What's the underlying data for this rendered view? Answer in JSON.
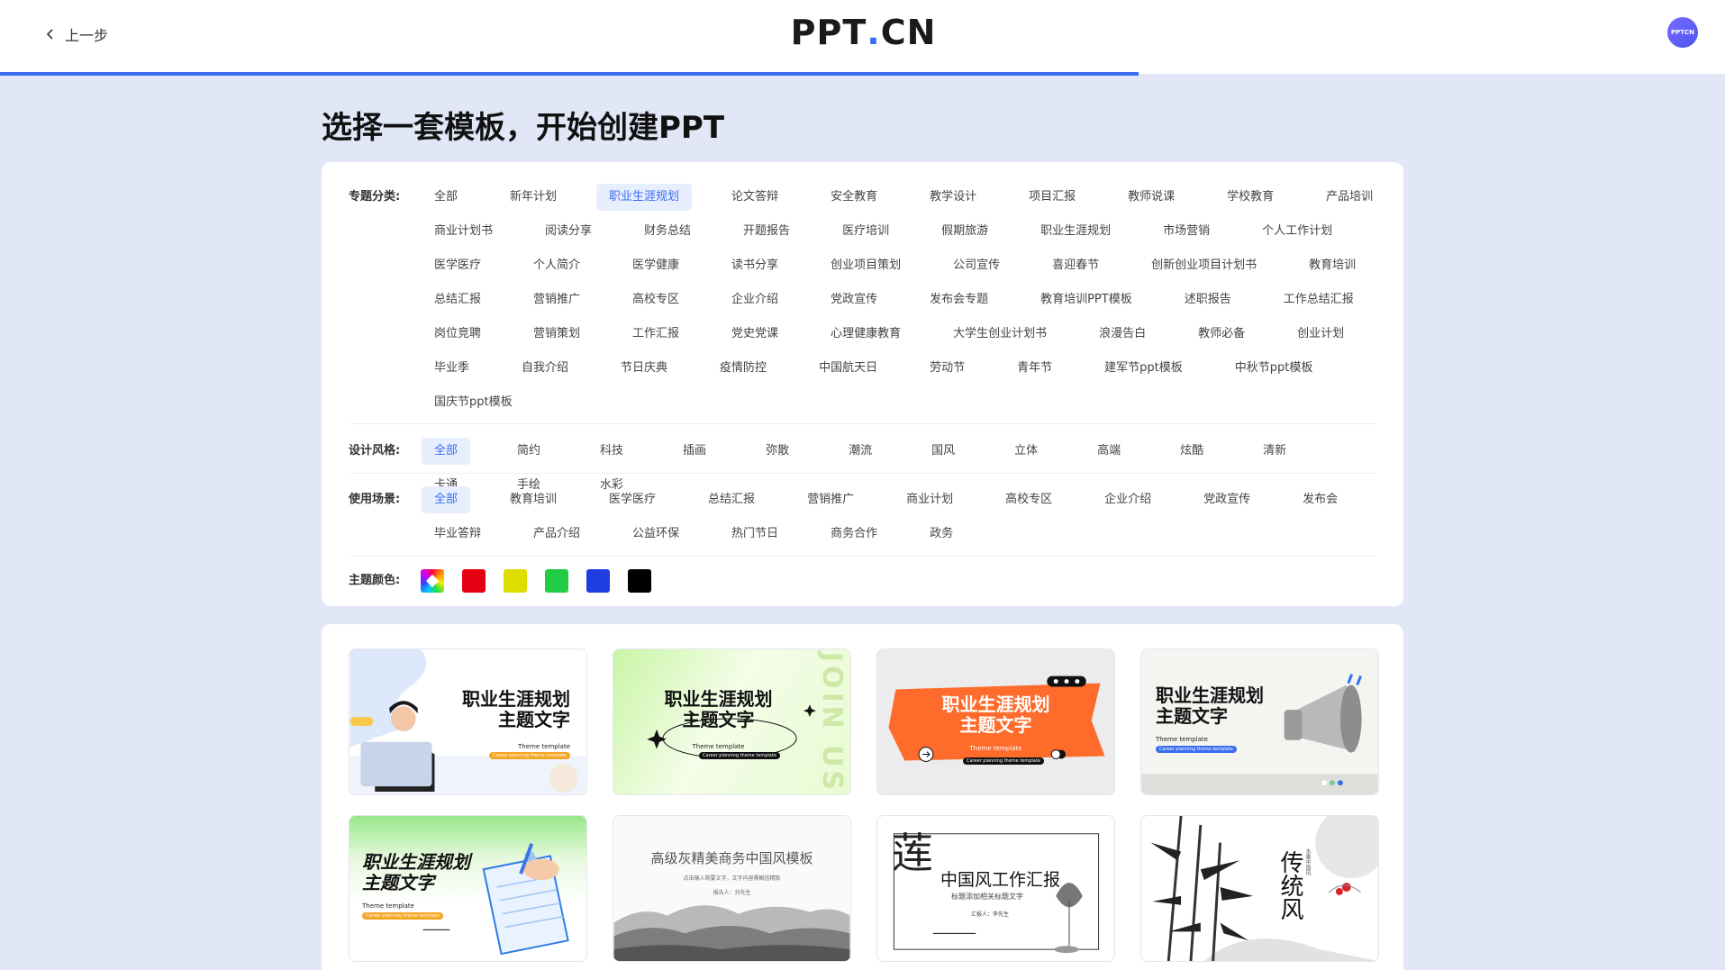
{
  "header": {
    "back_label": "上一步",
    "logo_text": "PPT.CN",
    "avatar_text": "PPTCN"
  },
  "page_title": "选择一套模板，开始创建PPT",
  "filters": {
    "topic": {
      "label": "专题分类:",
      "rows": [
        [
          "全部",
          "新年计划",
          "职业生涯规划",
          "论文答辩",
          "安全教育",
          "教学设计",
          "项目汇报",
          "教师说课",
          "学校教育",
          "产品培训"
        ],
        [
          "商业计划书",
          "阅读分享",
          "财务总结",
          "开题报告",
          "医疗培训",
          "假期旅游",
          "职业生涯规划",
          "市场营销",
          "个人工作计划"
        ],
        [
          "医学医疗",
          "个人简介",
          "医学健康",
          "读书分享",
          "创业项目策划",
          "公司宣传",
          "喜迎春节",
          "创新创业项目计划书",
          "教育培训"
        ],
        [
          "总结汇报",
          "营销推广",
          "高校专区",
          "企业介绍",
          "党政宣传",
          "发布会专题",
          "教育培训PPT模板",
          "述职报告",
          "工作总结汇报"
        ],
        [
          "岗位竞聘",
          "营销策划",
          "工作汇报",
          "党史党课",
          "心理健康教育",
          "大学生创业计划书",
          "浪漫告白",
          "教师必备",
          "创业计划"
        ],
        [
          "毕业季",
          "自我介绍",
          "节日庆典",
          "疫情防控",
          "中国航天日",
          "劳动节",
          "青年节",
          "建军节ppt模板",
          "中秋节ppt模板"
        ],
        [
          "国庆节ppt模板"
        ]
      ],
      "active": "职业生涯规划"
    },
    "style": {
      "label": "设计风格:",
      "items": [
        "全部",
        "简约",
        "科技",
        "插画",
        "弥散",
        "潮流",
        "国风",
        "立体",
        "高端",
        "炫酷",
        "清新",
        "卡通",
        "手绘",
        "水彩"
      ],
      "active": "全部"
    },
    "scene": {
      "label": "使用场景:",
      "rows": [
        [
          "全部",
          "教育培训",
          "医学医疗",
          "总结汇报",
          "营销推广",
          "商业计划",
          "高校专区",
          "企业介绍",
          "党政宣传",
          "发布会"
        ],
        [
          "毕业答辩",
          "产品介绍",
          "公益环保",
          "热门节日",
          "商务合作",
          "政务"
        ]
      ],
      "active": "全部"
    },
    "color": {
      "label": "主题颜色:",
      "swatches": [
        "multicolor",
        "#e60012",
        "#dddd00",
        "#22cc44",
        "#1e3ee0",
        "#000000"
      ]
    }
  },
  "templates": [
    {
      "title_line1": "职业生涯规划",
      "title_line2": "主题文字",
      "sub": "Theme template",
      "pill": "Career planning theme template"
    },
    {
      "title_line1": "职业生涯规划",
      "title_line2": "主题文字",
      "sub": "Theme template",
      "pill": "Career planning theme template",
      "side": "JOIN US"
    },
    {
      "title_line1": "职业生涯规划",
      "title_line2": "主题文字",
      "sub": "Theme template",
      "pill": "Career planning theme template"
    },
    {
      "title_line1": "职业生涯规划",
      "title_line2": "主题文字",
      "sub": "Theme template",
      "pill": "Career planning theme template"
    },
    {
      "title_line1": "职业生涯规划",
      "title_line2": "主题文字",
      "sub": "Theme template",
      "pill": "Career planning theme template"
    },
    {
      "title_line1": "高级灰精美商务中国风模板",
      "title_line2": "点击输入简要文字，文字内容需概括精炼",
      "sub": "报告人：刘先生"
    },
    {
      "title_line1": "中国风工作汇报",
      "title_line2": "标题添加相关标题文字",
      "sub": "汇报人：李先生",
      "big_char": "莲"
    },
    {
      "title_line1": "传统风",
      "title_line2": "水墨中国风"
    }
  ]
}
